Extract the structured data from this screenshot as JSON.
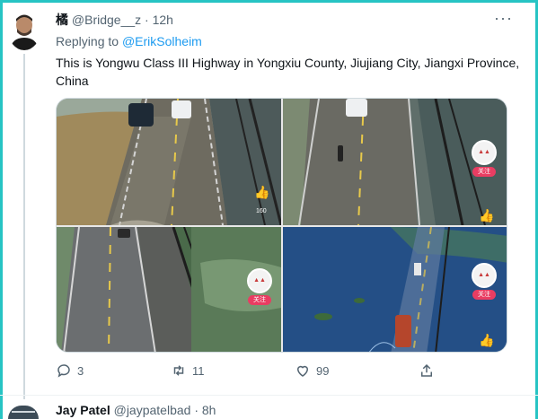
{
  "tweet": {
    "display_name": "橘",
    "handle": "@Bridge__z",
    "separator": "·",
    "time": "12h",
    "more_icon": "more-icon",
    "replying_prefix": "Replying to ",
    "replying_to": "@ErikSolheim",
    "text": "This is Yongwu Class III Highway in Yongxiu County, Jiujiang City, Jiangxi Province, China",
    "media_badge_follow": "关注",
    "media_count": "160",
    "actions": {
      "reply_count": "3",
      "retweet_count": "11",
      "like_count": "99"
    }
  },
  "next_tweet": {
    "display_name": "Jay Patel",
    "handle": "@jaypatelbad",
    "separator": "·",
    "time": "8h"
  },
  "colors": {
    "frame": "#27c4c4",
    "link": "#1d9bf0",
    "secondary_text": "#536471",
    "follow_badge": "#e93d62"
  }
}
